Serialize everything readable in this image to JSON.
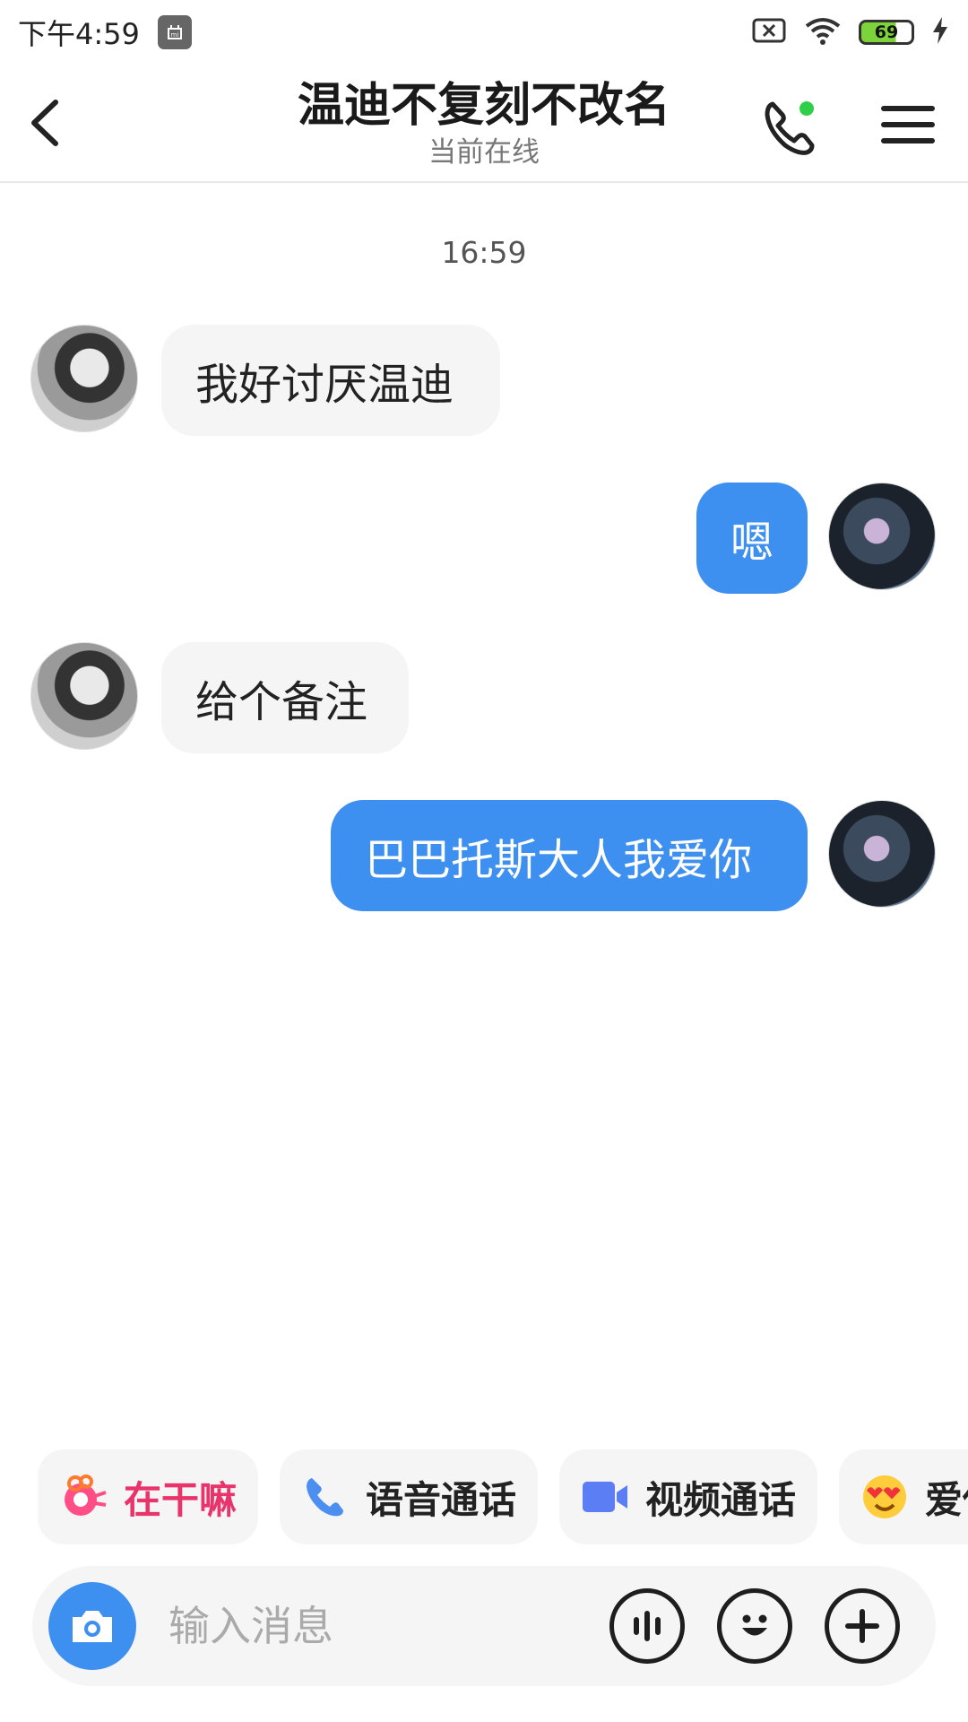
{
  "status_bar": {
    "time": "下午4:59",
    "battery_level": "69"
  },
  "header": {
    "title": "温迪不复刻不改名",
    "subtitle": "当前在线",
    "online_dot_color": "#2fcf4a"
  },
  "conversation": {
    "timestamp": "16:59",
    "messages": [
      {
        "from": "other",
        "text": "我好讨厌温迪"
      },
      {
        "from": "self",
        "text": "嗯"
      },
      {
        "from": "other",
        "text": "给个备注"
      },
      {
        "from": "self",
        "text": "巴巴托斯大人我爱你"
      }
    ]
  },
  "quick_actions": [
    {
      "label": "在干嘛",
      "icon": "gift-mascot-icon",
      "color": "#e8336b"
    },
    {
      "label": "语音通话",
      "icon": "phone-icon",
      "color": "#222222"
    },
    {
      "label": "视频通话",
      "icon": "video-camera-icon",
      "color": "#222222"
    },
    {
      "label": "爱你",
      "icon": "heart-eyes-emoji-icon",
      "color": "#222222"
    }
  ],
  "input_bar": {
    "placeholder": "输入消息"
  },
  "colors": {
    "accent": "#3d8ff0",
    "bubble_incoming": "#f5f5f5"
  }
}
